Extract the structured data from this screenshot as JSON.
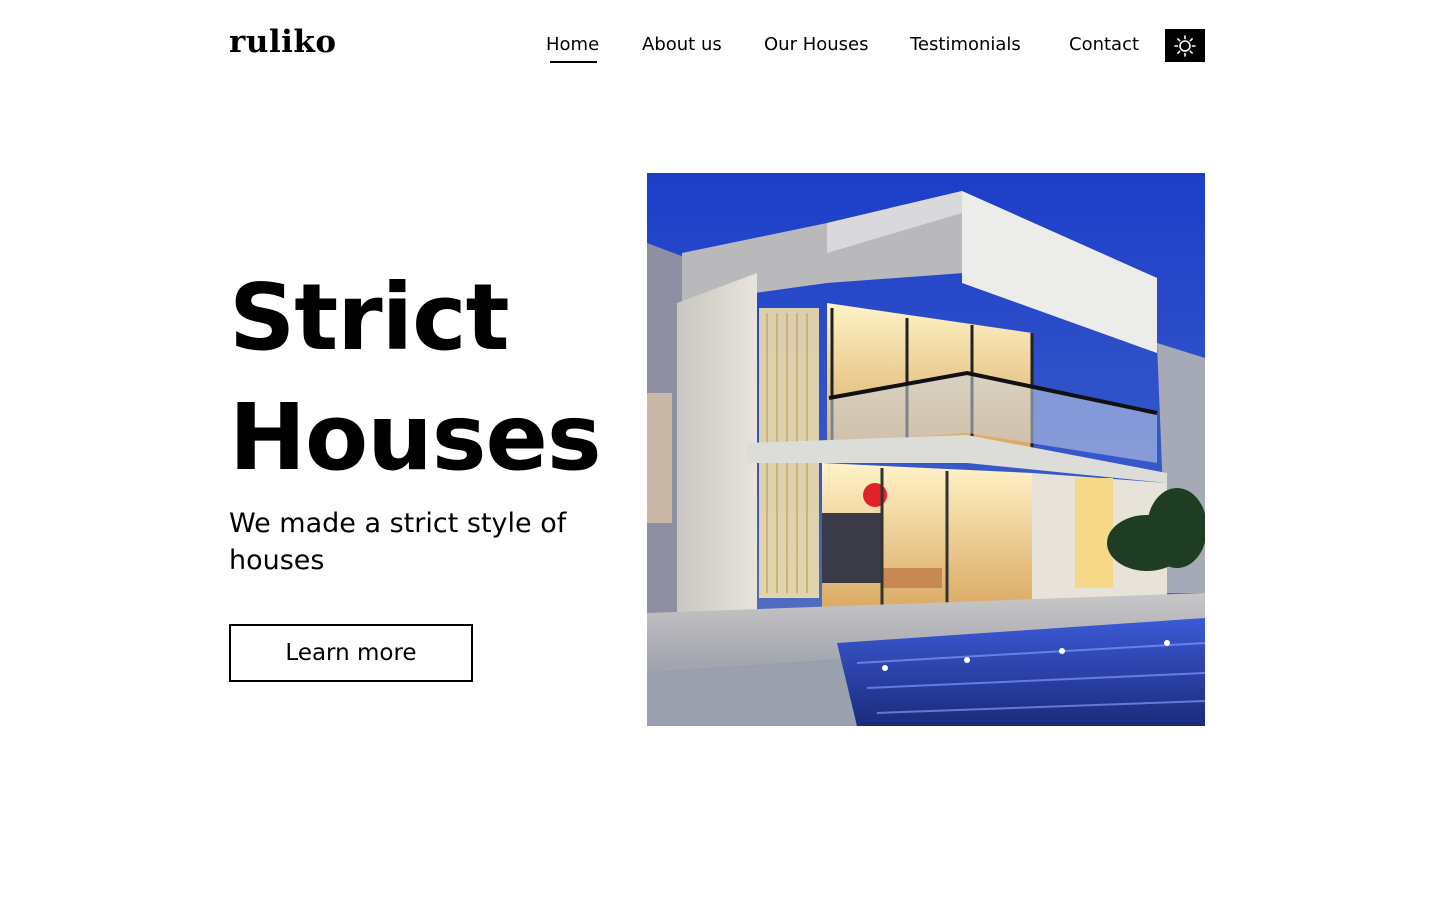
{
  "brand": {
    "name": "ruliko"
  },
  "nav": {
    "items": [
      {
        "label": "Home",
        "active": true
      },
      {
        "label": "About us"
      },
      {
        "label": "Our Houses"
      },
      {
        "label": "Testimonials"
      },
      {
        "label": "Contact"
      }
    ],
    "theme_toggle_icon": "sun-icon"
  },
  "hero": {
    "title_line1": "Strict",
    "title_line2": "Houses",
    "subtitle": "We made a strict style of houses",
    "cta_label": "Learn more",
    "image_subject": "modern-villa-photo"
  },
  "colors": {
    "text": "#000000",
    "background": "#ffffff",
    "toggle_bg": "#000000"
  }
}
